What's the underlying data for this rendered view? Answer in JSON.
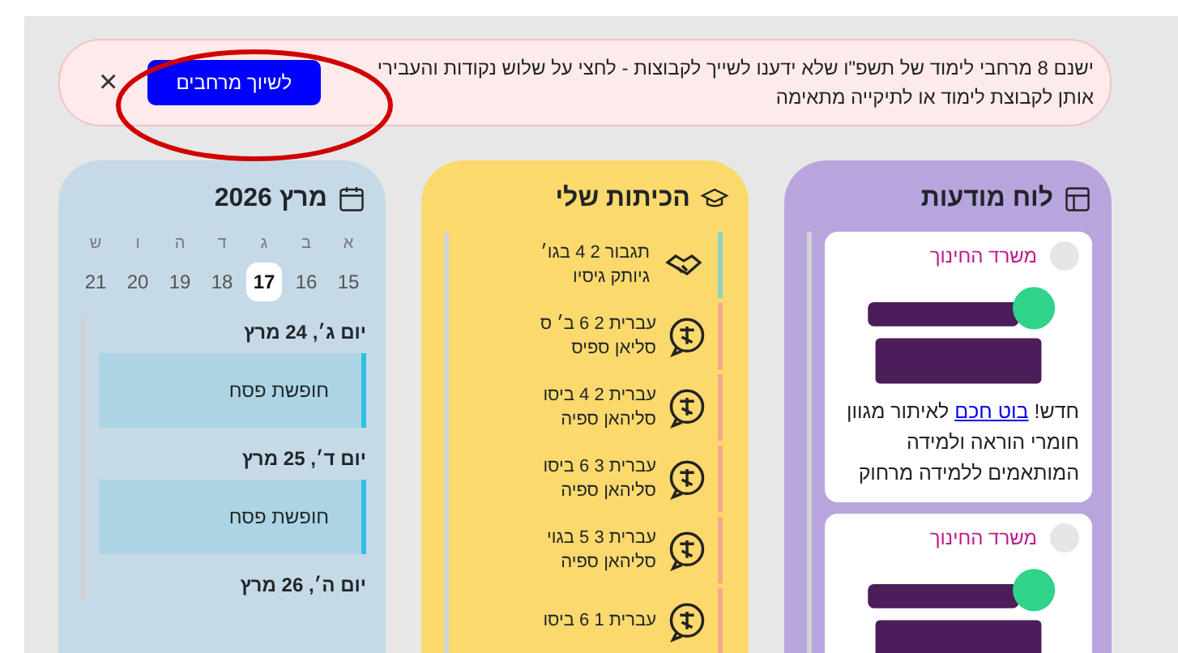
{
  "alert": {
    "text": "ישנם 8 מרחבי לימוד של תשפ\"ו שלא ידענו לשייך לקבוצות - לחצי על שלוש נקודות והעבירי אותן לקבוצת לימוד או לתיקייה מתאימה",
    "button": "לשיוך מרחבים",
    "close": "×"
  },
  "notice_board": {
    "title": "לוח מודעות",
    "posts": [
      {
        "author": "משרד החינוך",
        "text_before": "חדש!",
        "link": "בוט חכם",
        "text_after": "לאיתור מגוון חומרי הוראה ולמידה המותאמים ללמידה מרחוק"
      },
      {
        "author": "משרד החינוך"
      }
    ]
  },
  "classes": {
    "title": "הכיתות שלי",
    "items": [
      {
        "kind": "handshake",
        "name": "תגבור 2 4 בגו׳",
        "teacher": "גיותק גיסיו",
        "color": "#8fd3c0"
      },
      {
        "kind": "language",
        "name": "עברית 2 6 ב׳ ס",
        "teacher": "סליאן ספיס",
        "color": "#f4a98a"
      },
      {
        "kind": "language",
        "name": "עברית 2 4 ביסו",
        "teacher": "סליהאן ספיה",
        "color": "#f4a98a"
      },
      {
        "kind": "language",
        "name": "עברית 3 6 ביסו",
        "teacher": "סליהאן ספיה",
        "color": "#f4a98a"
      },
      {
        "kind": "language",
        "name": "עברית 3 5 בגוי",
        "teacher": "סליהאן ספיה",
        "color": "#f4a98a"
      },
      {
        "kind": "language",
        "name": "עברית 1 6 ביסו",
        "color": "#f4a98a"
      }
    ]
  },
  "calendar": {
    "title": "מרץ 2026",
    "weekdays": [
      "א",
      "ב",
      "ג",
      "ד",
      "ה",
      "ו",
      "ש"
    ],
    "days": [
      {
        "label": "15",
        "selected": false
      },
      {
        "label": "16",
        "selected": false
      },
      {
        "label": "17",
        "selected": true
      },
      {
        "label": "18",
        "selected": false
      },
      {
        "label": "19",
        "selected": false
      },
      {
        "label": "20",
        "selected": false
      },
      {
        "label": "21",
        "selected": false
      }
    ],
    "agenda": [
      {
        "date": "יום ג׳, 24 מרץ",
        "events": [
          "חופשת פסח"
        ]
      },
      {
        "date": "יום ד׳, 25 מרץ",
        "events": [
          "חופשת פסח"
        ]
      },
      {
        "date": "יום ה׳, 26 מרץ"
      }
    ]
  }
}
